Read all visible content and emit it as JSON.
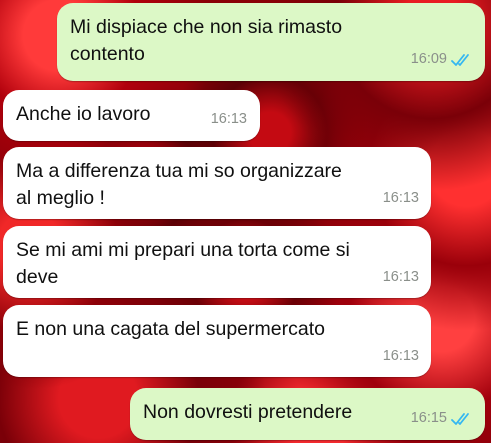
{
  "messages": [
    {
      "direction": "out",
      "text": "Mi dispiace che non sia rimasto contento",
      "time": "16:09",
      "status": "read",
      "lines": [
        "Mi dispiace che non sia rimasto",
        "contento"
      ]
    },
    {
      "direction": "in",
      "text": "Anche io lavoro",
      "time": "16:13",
      "lines": [
        "Anche io lavoro"
      ]
    },
    {
      "direction": "in",
      "text": "Ma a differenza tua mi so organizzare al meglio !",
      "time": "16:13",
      "lines": [
        "Ma a differenza tua mi so organizzare",
        "al meglio !"
      ]
    },
    {
      "direction": "in",
      "text": "Se mi ami mi prepari una torta come si deve",
      "time": "16:13",
      "lines": [
        "Se mi ami mi prepari una torta come si",
        "deve"
      ]
    },
    {
      "direction": "in",
      "text": "E non una cagata del supermercato",
      "time": "16:13",
      "lines": [
        "E non una cagata del supermercato"
      ]
    },
    {
      "direction": "out",
      "text": "Non dovresti pretendere",
      "time": "16:15",
      "status": "read",
      "lines": [
        "Non dovresti pretendere"
      ]
    }
  ],
  "colors": {
    "outgoing_bubble": "#dcf8c6",
    "incoming_bubble": "#ffffff",
    "read_ticks": "#34b7f1",
    "timestamp": "#8a8f8a",
    "wallpaper": "#8a0008"
  },
  "icons": {
    "read_receipt": "double-check-icon"
  },
  "wallpaper": "red roses"
}
